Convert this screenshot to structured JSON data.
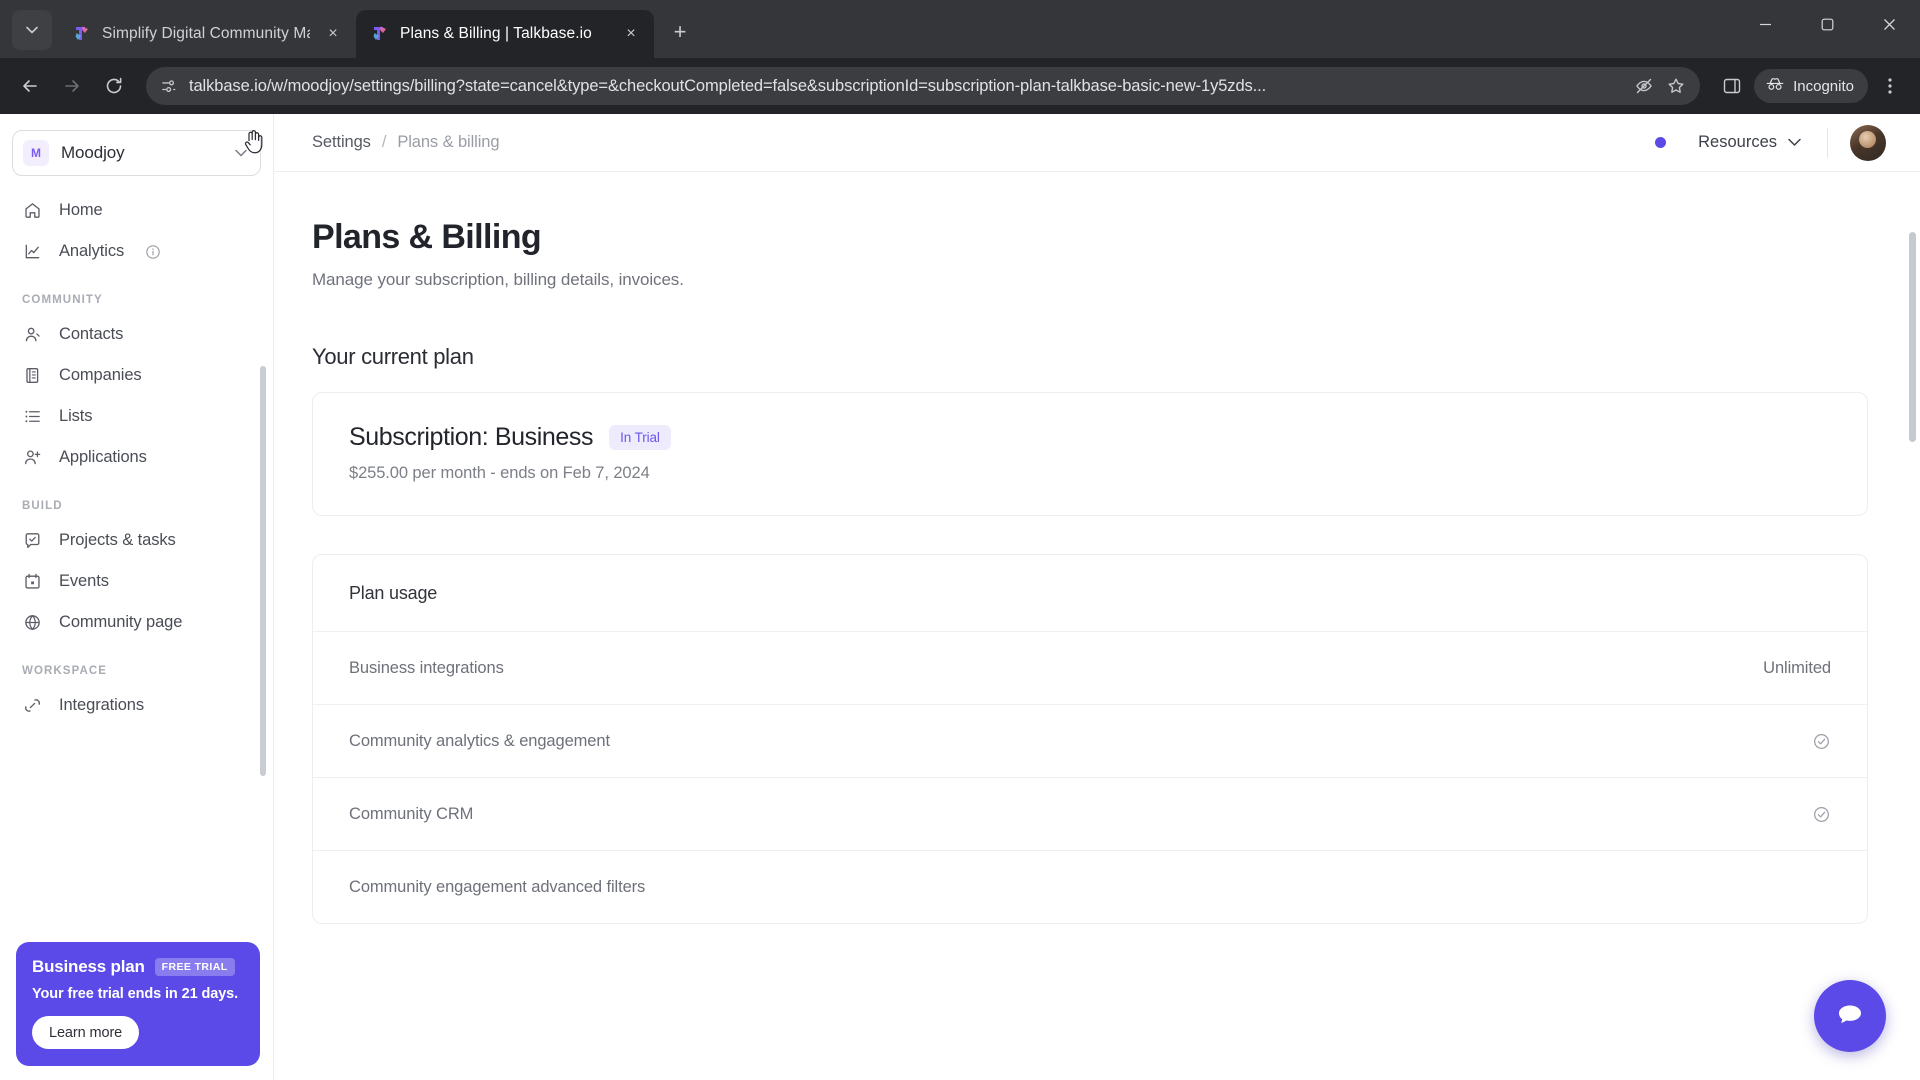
{
  "browser": {
    "tabs": [
      {
        "title": "Simplify Digital Community Ma",
        "active": false,
        "favicon": "talkbase-logo-icon",
        "close_label": "×"
      },
      {
        "title": "Plans & Billing | Talkbase.io",
        "active": true,
        "favicon": "talkbase-logo-icon",
        "close_label": "×"
      }
    ],
    "tab_list_caret": "⌄",
    "new_tab_label": "+",
    "window_controls": {
      "minimize": "—",
      "maximize": "❐",
      "close": "✕"
    },
    "nav": {
      "back": "←",
      "forward": "→",
      "reload": "↻"
    },
    "url": "talkbase.io/w/moodjoy/settings/billing?state=cancel&type=&checkoutCompleted=false&subscriptionId=subscription-plan-talkbase-basic-new-1y5zds...",
    "site_info_icon": "page-settings-icon",
    "hide_password_icon": "eye-slash-icon",
    "bookmark_icon": "star-icon",
    "side_panel_icon": "side-panel-icon",
    "incognito_label": "Incognito",
    "incognito_icon": "incognito-hat-icon",
    "menu_icon": "three-dot-menu-icon"
  },
  "sidebar": {
    "org": {
      "initial": "M",
      "name": "Moodjoy",
      "caret": "⌵"
    },
    "items": [
      {
        "label": "Home",
        "icon": "home-icon",
        "section": null
      },
      {
        "label": "Analytics",
        "icon": "chart-line-icon",
        "section": null,
        "info": true
      }
    ],
    "sections": [
      {
        "title": "COMMUNITY",
        "items": [
          {
            "label": "Contacts",
            "icon": "person-icon"
          },
          {
            "label": "Companies",
            "icon": "building-icon"
          },
          {
            "label": "Lists",
            "icon": "list-icon"
          },
          {
            "label": "Applications",
            "icon": "person-plus-icon"
          }
        ]
      },
      {
        "title": "BUILD",
        "items": [
          {
            "label": "Projects & tasks",
            "icon": "check-square-icon"
          },
          {
            "label": "Events",
            "icon": "calendar-icon"
          },
          {
            "label": "Community page",
            "icon": "globe-icon"
          }
        ]
      },
      {
        "title": "WORKSPACE",
        "items": [
          {
            "label": "Integrations",
            "icon": "plug-icon"
          }
        ]
      }
    ],
    "promo": {
      "title": "Business plan",
      "badge": "FREE TRIAL",
      "subtitle": "Your free trial ends in 21 days.",
      "button": "Learn more",
      "color": "#5b4ae8"
    }
  },
  "header": {
    "breadcrumb": {
      "parent": "Settings",
      "separator": "/",
      "current": "Plans & billing"
    },
    "resources_label": "Resources",
    "resources_caret": "⌵",
    "notification_dot_color": "#5b4ae8",
    "avatar_name": "user-avatar"
  },
  "main": {
    "title": "Plans & Billing",
    "subtitle": "Manage your subscription, billing details, invoices.",
    "section_title": "Your current plan",
    "subscription": {
      "title": "Subscription: Business",
      "status_badge": "In Trial",
      "meta": "$255.00 per month - ends on Feb 7, 2024"
    },
    "plan_usage": {
      "heading": "Plan usage",
      "rows": [
        {
          "label": "Business integrations",
          "value": "Unlimited",
          "check": false
        },
        {
          "label": "Community analytics & engagement",
          "value": "",
          "check": true
        },
        {
          "label": "Community CRM",
          "value": "",
          "check": true
        },
        {
          "label": "Community engagement advanced filters",
          "value": "",
          "check": false
        }
      ]
    },
    "chat_button": "chat-bubble-icon"
  }
}
